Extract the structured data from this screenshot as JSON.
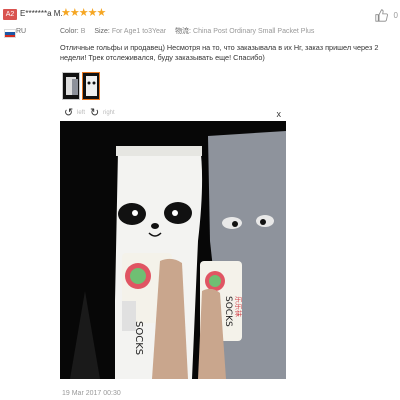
{
  "review": {
    "avatar_text": "A2",
    "username": "E*******a M.",
    "stars": "★★★★★",
    "country": "RU",
    "color_label": "Color:",
    "color_value": "B",
    "size_label": "Size:",
    "size_value": "For Age1 to3Year",
    "shipping_label": "物流:",
    "shipping_value": "China Post Ordinary Small Packet Plus",
    "text": "Отличные гольфы и продавец) Несмотря на то, что заказывала в их Нг, заказ пришел через 2 недели! Трек отслеживался, буду заказывать еще! Спасибо)",
    "date": "19 Mar 2017 00:30",
    "like_count": "0"
  },
  "viewer": {
    "left_label": "left",
    "right_label": "right",
    "close_label": "x",
    "photo_labels": {
      "socks_text": "SOCKS",
      "cn_text": "乐乐袜"
    }
  },
  "colors": {
    "star": "#f5a623",
    "avatar": "#d9534f",
    "accent": "#e87722"
  }
}
